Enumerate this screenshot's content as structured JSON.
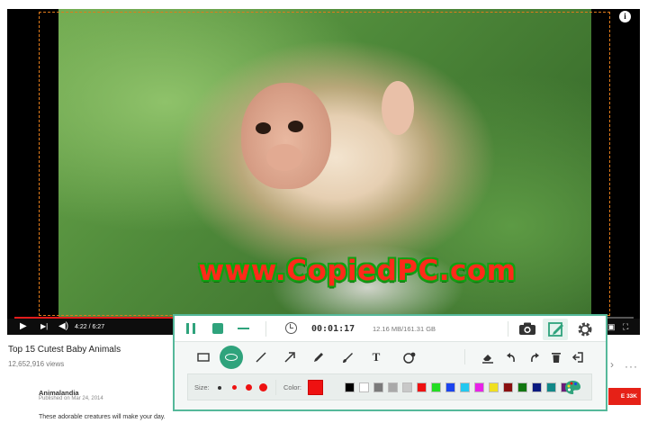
{
  "player": {
    "time_display": "4:22 / 6:27",
    "progress_fraction": 0.68,
    "info_glyph": "i"
  },
  "watermark": "www.CopiedPC.com",
  "page": {
    "video_title": "Top 15 Cutest Baby Animals",
    "view_count": "12,652,916 views",
    "channel_name": "Animalandia",
    "publish_date": "Published on Mar 24, 2014",
    "description": "These adorable creatures will make your day.",
    "subscribe_label": "E 33K"
  },
  "recorder": {
    "timer": "00:01:17",
    "storage": "12.16 MB/161.31 GB",
    "size_label": "Size:",
    "color_label": "Color:",
    "current_color": "#ee1111",
    "tools": [
      "rectangle-icon",
      "ellipse-icon",
      "line-icon",
      "arrow-icon",
      "pen-icon",
      "brush-icon",
      "text-icon",
      "step-number-icon",
      "eraser-icon",
      "undo-icon",
      "redo-icon",
      "delete-icon",
      "exit-icon"
    ],
    "palette": [
      "#000000",
      "#ffffff",
      "#7a7a7a",
      "#a9a9a9",
      "#c8c8c8",
      "#ee1111",
      "#22dd22",
      "#1a44ee",
      "#22c8f0",
      "#e822e8",
      "#f0e020",
      "#8a1010",
      "#117711",
      "#0a1a80",
      "#118888",
      "#6a1c7a"
    ],
    "accent": "#2fa37c"
  }
}
